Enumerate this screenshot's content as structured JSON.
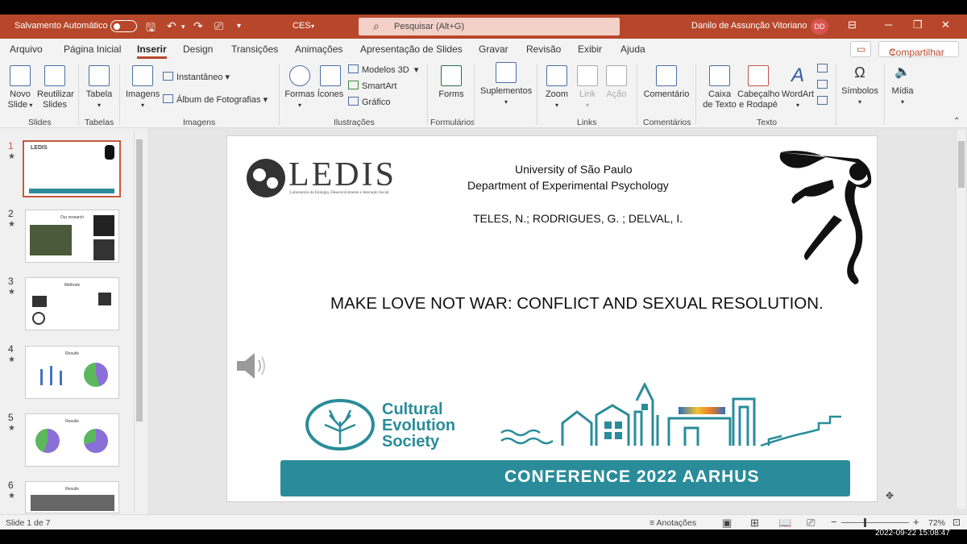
{
  "titlebar": {
    "autosave_label": "Salvamento Automático",
    "doc_name": "CES",
    "search_placeholder": "Pesquisar (Alt+G)",
    "user_name": "Danilo de Assunção Vitoriano",
    "user_initials": "DD",
    "bg_color": "#b7472a"
  },
  "menu": {
    "tabs": [
      "Arquivo",
      "Página Inicial",
      "Inserir",
      "Design",
      "Transições",
      "Animações",
      "Apresentação de Slides",
      "Gravar",
      "Revisão",
      "Exibir",
      "Ajuda"
    ],
    "active_tab": "Inserir",
    "share_label": "Compartilhar"
  },
  "ribbon": {
    "slides": {
      "group": "Slides",
      "new_slide": "Novo",
      "new_slide2": "Slide",
      "reuse": "Reutilizar",
      "reuse2": "Slides"
    },
    "tables": {
      "group": "Tabelas",
      "table": "Tabela"
    },
    "images": {
      "group": "Imagens",
      "images": "Imagens",
      "screenshot": "Instantâneo",
      "album": "Álbum de Fotografias"
    },
    "illustrations": {
      "group": "Ilustrações",
      "shapes": "Formas",
      "icons": "Ícones",
      "models3d": "Modelos 3D",
      "smartart": "SmartArt",
      "chart": "Gráfico"
    },
    "forms": {
      "group": "Formulários",
      "forms": "Forms"
    },
    "addins": {
      "addins": "Suplementos"
    },
    "links": {
      "group": "Links",
      "zoom": "Zoom",
      "link": "Link",
      "action": "Ação"
    },
    "comments": {
      "group": "Comentários",
      "comment": "Comentário"
    },
    "text": {
      "group": "Texto",
      "textbox": "Caixa",
      "textbox2": "de Texto",
      "header": "Cabeçalho",
      "header2": "e Rodapé",
      "wordart": "WordArt"
    },
    "symbols": {
      "symbols": "Símbolos"
    },
    "media": {
      "media": "Mídia"
    }
  },
  "thumbnails": {
    "numbers": [
      "1",
      "2",
      "3",
      "4",
      "5",
      "6"
    ],
    "titles": [
      "LEDIS",
      "Our research",
      "Methods",
      "Results",
      "Results",
      "Results"
    ]
  },
  "slide": {
    "logo_text": "LEDIS",
    "logo_subtitle": "Laboratório de Etologia, Desenvolvimento e Interação Social",
    "university": "University of São Paulo",
    "department": "Department of Experimental Psychology",
    "authors": "TELES, N.; RODRIGUES, G. ; DELVAL, I.",
    "title": "MAKE LOVE NOT WAR: CONFLICT AND SEXUAL RESOLUTION.",
    "society_line1": "Cultural",
    "society_line2": "Evolution",
    "society_line3": "Society",
    "conference": "CONFERENCE  2022 AARHUS",
    "teal_color": "#2a8c9a"
  },
  "status": {
    "slide_counter": "Slide 1 de 7",
    "notes": "Anotações",
    "zoom": "72%"
  },
  "timestamp": "2022-09-22  15:08:47"
}
